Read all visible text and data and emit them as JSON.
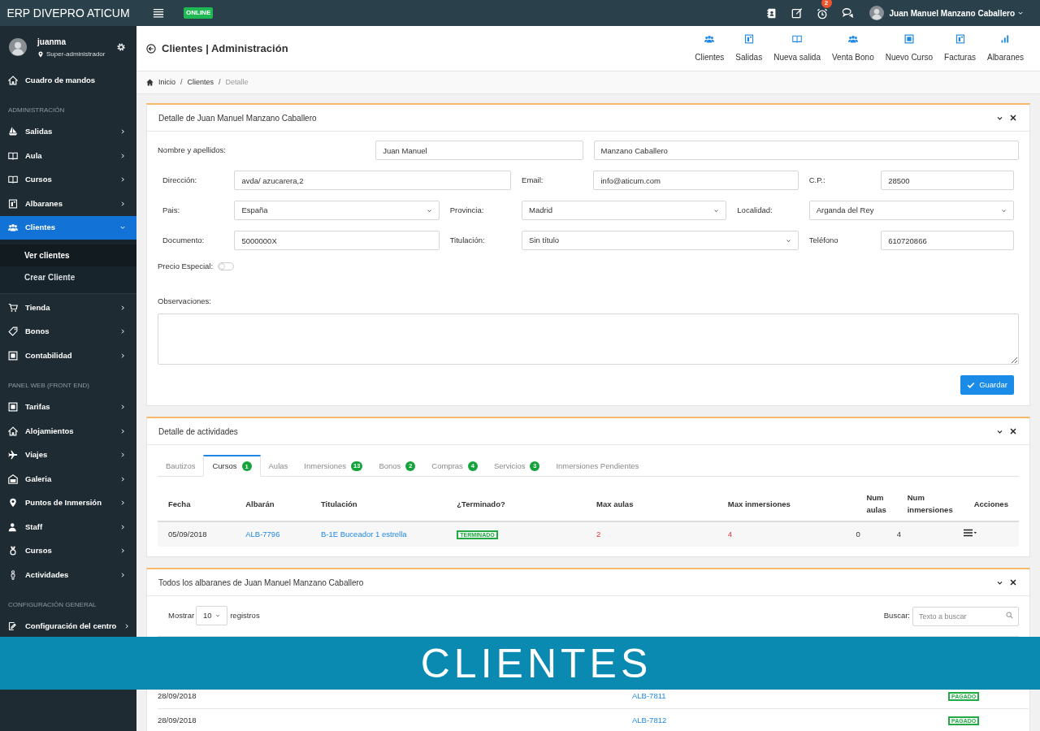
{
  "topbar": {
    "brand": "ERP DIVEPRO ATICUM",
    "status": "ONLINE",
    "notification_count": "2",
    "user_name": "Juan Manuel Manzano Caballero"
  },
  "sidebar": {
    "user": {
      "name": "juanma",
      "role": "Super-administrador"
    },
    "items": [
      {
        "kind": "item",
        "label": "Cuadro de mandos"
      },
      {
        "kind": "section",
        "label": "ADMINISTRACIÓN"
      },
      {
        "kind": "item",
        "label": "Salidas",
        "expanded": false,
        "selected": false
      },
      {
        "kind": "item",
        "label": "Aula",
        "expanded": false,
        "selected": false
      },
      {
        "kind": "item",
        "label": "Cursos",
        "expanded": false,
        "selected": false
      },
      {
        "kind": "item",
        "label": "Albaranes",
        "expanded": false,
        "selected": false
      },
      {
        "kind": "item",
        "label": "Clientes",
        "expanded": true,
        "selected": true,
        "children": [
          {
            "label": "Ver clientes",
            "selected": true
          },
          {
            "label": "Crear Cliente",
            "selected": false
          }
        ]
      },
      {
        "kind": "item",
        "label": "Tienda",
        "expanded": false,
        "selected": false
      },
      {
        "kind": "item",
        "label": "Bonos",
        "expanded": false,
        "selected": false
      },
      {
        "kind": "item",
        "label": "Contabilidad",
        "expanded": false,
        "selected": false
      },
      {
        "kind": "section",
        "label": "PANEL WEB (FRONT END)"
      },
      {
        "kind": "item",
        "label": "Tarifas",
        "expanded": false,
        "selected": false
      },
      {
        "kind": "item",
        "label": "Alojamientos",
        "expanded": false,
        "selected": false
      },
      {
        "kind": "item",
        "label": "Viajes",
        "expanded": false,
        "selected": false
      },
      {
        "kind": "item",
        "label": "Galeria",
        "expanded": false,
        "selected": false
      },
      {
        "kind": "item",
        "label": "Puntos de Inmersión",
        "expanded": false,
        "selected": false
      },
      {
        "kind": "item",
        "label": "Staff",
        "expanded": false,
        "selected": false
      },
      {
        "kind": "item",
        "label": "Cursos",
        "expanded": false,
        "selected": false
      },
      {
        "kind": "item",
        "label": "Actividades",
        "expanded": false,
        "selected": false
      },
      {
        "kind": "section",
        "label": "CONFIGURACIÓN GENERAL"
      },
      {
        "kind": "item",
        "label": "Configuración del centro",
        "expanded": false,
        "selected": false
      }
    ]
  },
  "header": {
    "title": "Clientes | Administración",
    "shortcuts": [
      "Clientes",
      "Salidas",
      "Nueva salida",
      "Venta Bono",
      "Nuevo Curso",
      "Facturas",
      "Albaranes"
    ]
  },
  "breadcrumb": [
    {
      "kind": "link",
      "text": "Inicio"
    },
    {
      "kind": "separator",
      "text": "/"
    },
    {
      "kind": "link",
      "text": "Clientes"
    },
    {
      "kind": "separator",
      "text": "/"
    },
    {
      "kind": "current",
      "text": "Detalle"
    }
  ],
  "client_panel": {
    "title": "Detalle de Juan Manuel Manzano Caballero",
    "fields": [
      {
        "label": "Nombre y apellidos:",
        "kind": "input",
        "value": "Juan Manuel"
      },
      {
        "kind": "input",
        "value": "Manzano Caballero"
      },
      {
        "label": "Dirección:",
        "kind": "input",
        "value": "avda/ azucarera,2"
      },
      {
        "label": "Email:",
        "kind": "input",
        "value": "info@aticum.com"
      },
      {
        "label": "C.P.:",
        "kind": "input",
        "value": "28500"
      },
      {
        "label": "Pais:",
        "kind": "select",
        "value": "España"
      },
      {
        "label": "Provincia:",
        "kind": "select",
        "value": "Madrid"
      },
      {
        "label": "Localidad:",
        "kind": "select",
        "value": "Arganda del Rey"
      },
      {
        "label": "Documento:",
        "kind": "input",
        "value": "5000000X"
      },
      {
        "label": "Titulación:",
        "kind": "select",
        "value": "Sin título"
      },
      {
        "label": "Teléfono",
        "kind": "input",
        "value": "610720866"
      }
    ],
    "special_price": {
      "label": "Precio Especial:",
      "on": false
    },
    "notes": {
      "label": "Observaciones:"
    },
    "save_button": "Guardar"
  },
  "activities_panel": {
    "title": "Detalle de actividades",
    "tabs": [
      {
        "label": "Bautizos",
        "selected": false
      },
      {
        "label": "Cursos",
        "count": "1",
        "selected": true
      },
      {
        "label": "Aulas",
        "selected": false
      },
      {
        "label": "Inmersiones",
        "count": "13",
        "selected": false
      },
      {
        "label": "Bonos",
        "count": "2",
        "selected": false
      },
      {
        "label": "Compras",
        "count": "4",
        "selected": false
      },
      {
        "label": "Servicios",
        "count": "3",
        "selected": false
      },
      {
        "label": "Inmersiones Pendientes",
        "selected": false
      }
    ],
    "columns": [
      "Fecha",
      "Albarán",
      "Titulación",
      "¿Terminado?",
      "Max aulas",
      "Max inmersiones",
      "Num aulas",
      "Num inmersiones",
      "Acciones"
    ],
    "rows": [
      [
        {
          "kind": "text",
          "text": "05/09/2018"
        },
        {
          "kind": "link",
          "text": "ALB-7796"
        },
        {
          "kind": "link",
          "text": "B-1E Buceador 1 estrella"
        },
        {
          "kind": "badge",
          "text": "TERMINADO",
          "color": "#22aa44"
        },
        {
          "kind": "alert",
          "text": "2"
        },
        {
          "kind": "alert",
          "text": "4"
        },
        {
          "kind": "text",
          "text": "0"
        },
        {
          "kind": "text",
          "text": "4"
        },
        {
          "kind": "menu"
        }
      ]
    ]
  },
  "invoices_panel": {
    "title": "Todos los albaranes de Juan Manuel Manzano Caballero",
    "show_label": "Mostrar",
    "page_size": "10",
    "records_label": "registros",
    "search_label": "Buscar:",
    "search_placeholder": "Texto a buscar",
    "rows": [
      {
        "created": "28/09/2018",
        "invoice": "ALB-7811",
        "status": "PAGADO",
        "color": "#22aa44"
      },
      {
        "created": "28/09/2018",
        "invoice": "ALB-7812",
        "status": "PAGADO",
        "color": "#22aa44"
      }
    ]
  },
  "banner": "CLIENTES"
}
